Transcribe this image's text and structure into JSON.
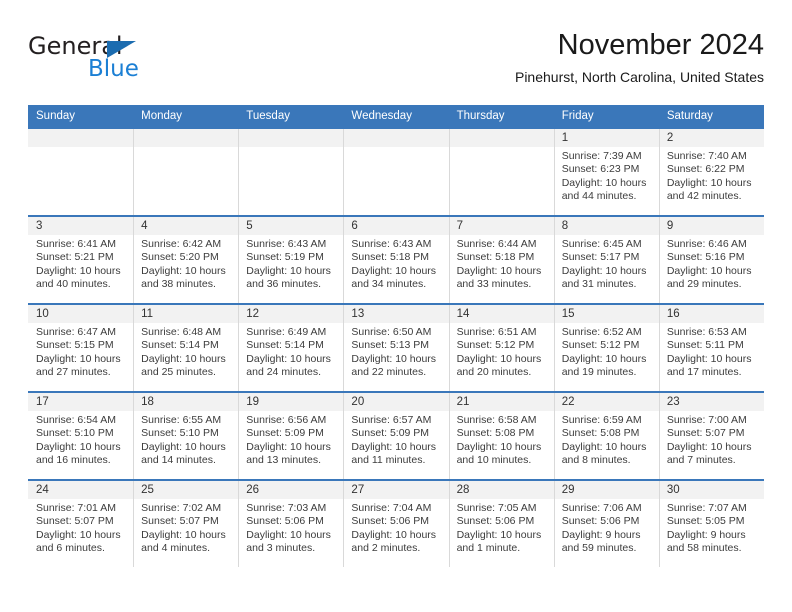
{
  "brand": {
    "word1": "General",
    "word2": "Blue",
    "accent_color": "#1b7fd4",
    "triangle_color": "#1b6cb0"
  },
  "header": {
    "title": "November 2024",
    "subtitle": "Pinehurst, North Carolina, United States"
  },
  "calendar": {
    "header_color": "#3a77ba",
    "weekday_headers": [
      "Sunday",
      "Monday",
      "Tuesday",
      "Wednesday",
      "Thursday",
      "Friday",
      "Saturday"
    ],
    "weeks": [
      [
        {
          "day": "",
          "empty": true,
          "sunrise": "",
          "sunset": "",
          "daylight1": "",
          "daylight2": ""
        },
        {
          "day": "",
          "empty": true,
          "sunrise": "",
          "sunset": "",
          "daylight1": "",
          "daylight2": ""
        },
        {
          "day": "",
          "empty": true,
          "sunrise": "",
          "sunset": "",
          "daylight1": "",
          "daylight2": ""
        },
        {
          "day": "",
          "empty": true,
          "sunrise": "",
          "sunset": "",
          "daylight1": "",
          "daylight2": ""
        },
        {
          "day": "",
          "empty": true,
          "sunrise": "",
          "sunset": "",
          "daylight1": "",
          "daylight2": ""
        },
        {
          "day": "1",
          "empty": false,
          "sunrise": "Sunrise: 7:39 AM",
          "sunset": "Sunset: 6:23 PM",
          "daylight1": "Daylight: 10 hours",
          "daylight2": "and 44 minutes."
        },
        {
          "day": "2",
          "empty": false,
          "sunrise": "Sunrise: 7:40 AM",
          "sunset": "Sunset: 6:22 PM",
          "daylight1": "Daylight: 10 hours",
          "daylight2": "and 42 minutes."
        }
      ],
      [
        {
          "day": "3",
          "empty": false,
          "sunrise": "Sunrise: 6:41 AM",
          "sunset": "Sunset: 5:21 PM",
          "daylight1": "Daylight: 10 hours",
          "daylight2": "and 40 minutes."
        },
        {
          "day": "4",
          "empty": false,
          "sunrise": "Sunrise: 6:42 AM",
          "sunset": "Sunset: 5:20 PM",
          "daylight1": "Daylight: 10 hours",
          "daylight2": "and 38 minutes."
        },
        {
          "day": "5",
          "empty": false,
          "sunrise": "Sunrise: 6:43 AM",
          "sunset": "Sunset: 5:19 PM",
          "daylight1": "Daylight: 10 hours",
          "daylight2": "and 36 minutes."
        },
        {
          "day": "6",
          "empty": false,
          "sunrise": "Sunrise: 6:43 AM",
          "sunset": "Sunset: 5:18 PM",
          "daylight1": "Daylight: 10 hours",
          "daylight2": "and 34 minutes."
        },
        {
          "day": "7",
          "empty": false,
          "sunrise": "Sunrise: 6:44 AM",
          "sunset": "Sunset: 5:18 PM",
          "daylight1": "Daylight: 10 hours",
          "daylight2": "and 33 minutes."
        },
        {
          "day": "8",
          "empty": false,
          "sunrise": "Sunrise: 6:45 AM",
          "sunset": "Sunset: 5:17 PM",
          "daylight1": "Daylight: 10 hours",
          "daylight2": "and 31 minutes."
        },
        {
          "day": "9",
          "empty": false,
          "sunrise": "Sunrise: 6:46 AM",
          "sunset": "Sunset: 5:16 PM",
          "daylight1": "Daylight: 10 hours",
          "daylight2": "and 29 minutes."
        }
      ],
      [
        {
          "day": "10",
          "empty": false,
          "sunrise": "Sunrise: 6:47 AM",
          "sunset": "Sunset: 5:15 PM",
          "daylight1": "Daylight: 10 hours",
          "daylight2": "and 27 minutes."
        },
        {
          "day": "11",
          "empty": false,
          "sunrise": "Sunrise: 6:48 AM",
          "sunset": "Sunset: 5:14 PM",
          "daylight1": "Daylight: 10 hours",
          "daylight2": "and 25 minutes."
        },
        {
          "day": "12",
          "empty": false,
          "sunrise": "Sunrise: 6:49 AM",
          "sunset": "Sunset: 5:14 PM",
          "daylight1": "Daylight: 10 hours",
          "daylight2": "and 24 minutes."
        },
        {
          "day": "13",
          "empty": false,
          "sunrise": "Sunrise: 6:50 AM",
          "sunset": "Sunset: 5:13 PM",
          "daylight1": "Daylight: 10 hours",
          "daylight2": "and 22 minutes."
        },
        {
          "day": "14",
          "empty": false,
          "sunrise": "Sunrise: 6:51 AM",
          "sunset": "Sunset: 5:12 PM",
          "daylight1": "Daylight: 10 hours",
          "daylight2": "and 20 minutes."
        },
        {
          "day": "15",
          "empty": false,
          "sunrise": "Sunrise: 6:52 AM",
          "sunset": "Sunset: 5:12 PM",
          "daylight1": "Daylight: 10 hours",
          "daylight2": "and 19 minutes."
        },
        {
          "day": "16",
          "empty": false,
          "sunrise": "Sunrise: 6:53 AM",
          "sunset": "Sunset: 5:11 PM",
          "daylight1": "Daylight: 10 hours",
          "daylight2": "and 17 minutes."
        }
      ],
      [
        {
          "day": "17",
          "empty": false,
          "sunrise": "Sunrise: 6:54 AM",
          "sunset": "Sunset: 5:10 PM",
          "daylight1": "Daylight: 10 hours",
          "daylight2": "and 16 minutes."
        },
        {
          "day": "18",
          "empty": false,
          "sunrise": "Sunrise: 6:55 AM",
          "sunset": "Sunset: 5:10 PM",
          "daylight1": "Daylight: 10 hours",
          "daylight2": "and 14 minutes."
        },
        {
          "day": "19",
          "empty": false,
          "sunrise": "Sunrise: 6:56 AM",
          "sunset": "Sunset: 5:09 PM",
          "daylight1": "Daylight: 10 hours",
          "daylight2": "and 13 minutes."
        },
        {
          "day": "20",
          "empty": false,
          "sunrise": "Sunrise: 6:57 AM",
          "sunset": "Sunset: 5:09 PM",
          "daylight1": "Daylight: 10 hours",
          "daylight2": "and 11 minutes."
        },
        {
          "day": "21",
          "empty": false,
          "sunrise": "Sunrise: 6:58 AM",
          "sunset": "Sunset: 5:08 PM",
          "daylight1": "Daylight: 10 hours",
          "daylight2": "and 10 minutes."
        },
        {
          "day": "22",
          "empty": false,
          "sunrise": "Sunrise: 6:59 AM",
          "sunset": "Sunset: 5:08 PM",
          "daylight1": "Daylight: 10 hours",
          "daylight2": "and 8 minutes."
        },
        {
          "day": "23",
          "empty": false,
          "sunrise": "Sunrise: 7:00 AM",
          "sunset": "Sunset: 5:07 PM",
          "daylight1": "Daylight: 10 hours",
          "daylight2": "and 7 minutes."
        }
      ],
      [
        {
          "day": "24",
          "empty": false,
          "sunrise": "Sunrise: 7:01 AM",
          "sunset": "Sunset: 5:07 PM",
          "daylight1": "Daylight: 10 hours",
          "daylight2": "and 6 minutes."
        },
        {
          "day": "25",
          "empty": false,
          "sunrise": "Sunrise: 7:02 AM",
          "sunset": "Sunset: 5:07 PM",
          "daylight1": "Daylight: 10 hours",
          "daylight2": "and 4 minutes."
        },
        {
          "day": "26",
          "empty": false,
          "sunrise": "Sunrise: 7:03 AM",
          "sunset": "Sunset: 5:06 PM",
          "daylight1": "Daylight: 10 hours",
          "daylight2": "and 3 minutes."
        },
        {
          "day": "27",
          "empty": false,
          "sunrise": "Sunrise: 7:04 AM",
          "sunset": "Sunset: 5:06 PM",
          "daylight1": "Daylight: 10 hours",
          "daylight2": "and 2 minutes."
        },
        {
          "day": "28",
          "empty": false,
          "sunrise": "Sunrise: 7:05 AM",
          "sunset": "Sunset: 5:06 PM",
          "daylight1": "Daylight: 10 hours",
          "daylight2": "and 1 minute."
        },
        {
          "day": "29",
          "empty": false,
          "sunrise": "Sunrise: 7:06 AM",
          "sunset": "Sunset: 5:06 PM",
          "daylight1": "Daylight: 9 hours",
          "daylight2": "and 59 minutes."
        },
        {
          "day": "30",
          "empty": false,
          "sunrise": "Sunrise: 7:07 AM",
          "sunset": "Sunset: 5:05 PM",
          "daylight1": "Daylight: 9 hours",
          "daylight2": "and 58 minutes."
        }
      ]
    ]
  }
}
